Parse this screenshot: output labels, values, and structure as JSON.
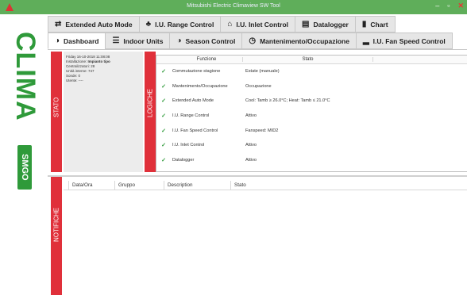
{
  "window": {
    "title": "Mitsubishi Electric Climaview SW Tool",
    "controls": [
      "–",
      "▫",
      "✕"
    ]
  },
  "brand": {
    "name": "CLIMA",
    "sub": "SMGO"
  },
  "tabs_row1": [
    {
      "label": "Extended Auto Mode",
      "icon": "⇄"
    },
    {
      "label": "I.U. Range Control",
      "icon": "♣"
    },
    {
      "label": "I.U. Inlet Control",
      "icon": "⌂"
    },
    {
      "label": "Datalogger",
      "icon": "▤"
    },
    {
      "label": "Chart",
      "icon": "▮"
    }
  ],
  "tabs_row2": [
    {
      "label": "Dashboard",
      "icon": "◑"
    },
    {
      "label": "Indoor Units",
      "icon": "☰"
    },
    {
      "label": "Season Control",
      "icon": "◑"
    },
    {
      "label": "Mantenimento/Occupazione",
      "icon": "◷"
    },
    {
      "label": "I.U. Fan Speed Control",
      "icon": "▂"
    }
  ],
  "stato": {
    "band_label": "STATO",
    "lines": [
      {
        "label": "Friday 16-10-2018 11:08:08",
        "value": ""
      },
      {
        "label": "Installazione:",
        "value": "Impianto tipo"
      },
      {
        "label": "Centralizzatori: 28",
        "value": ""
      },
      {
        "label": "Unità interne: 747",
        "value": ""
      },
      {
        "label": "Sonde: 0",
        "value": ""
      },
      {
        "label": "Utente: ----",
        "value": ""
      }
    ]
  },
  "logiche": {
    "band_label": "LOGICHE",
    "col_funzione": "Funzione",
    "col_stato": "Stato",
    "rows": [
      {
        "funzione": "Commutazione stagione",
        "stato": "Estate (manuale)"
      },
      {
        "funzione": "Mantenimento/Occupazione",
        "stato": "Occupazione"
      },
      {
        "funzione": "Extended Auto Mode",
        "stato": "Cool: Tamb ≥ 26.0°C; Heat: Tamb ≤ 21.0°C"
      },
      {
        "funzione": "I.U. Range Control",
        "stato": "Attivo"
      },
      {
        "funzione": "I.U. Fan Speed Control",
        "stato": "Fanspeed: MID2"
      },
      {
        "funzione": "I.U. Inlet Control",
        "stato": "Attivo"
      },
      {
        "funzione": "Datalogger",
        "stato": "Attivo"
      }
    ]
  },
  "notifiche": {
    "band_label": "NOTIFICHE",
    "columns": [
      "Data/Ora",
      "Gruppo",
      "Description",
      "Stato"
    ]
  },
  "colors": {
    "accent_green": "#2f9a3a",
    "title_green": "#5fae5a",
    "band_red": "#e0303a"
  }
}
